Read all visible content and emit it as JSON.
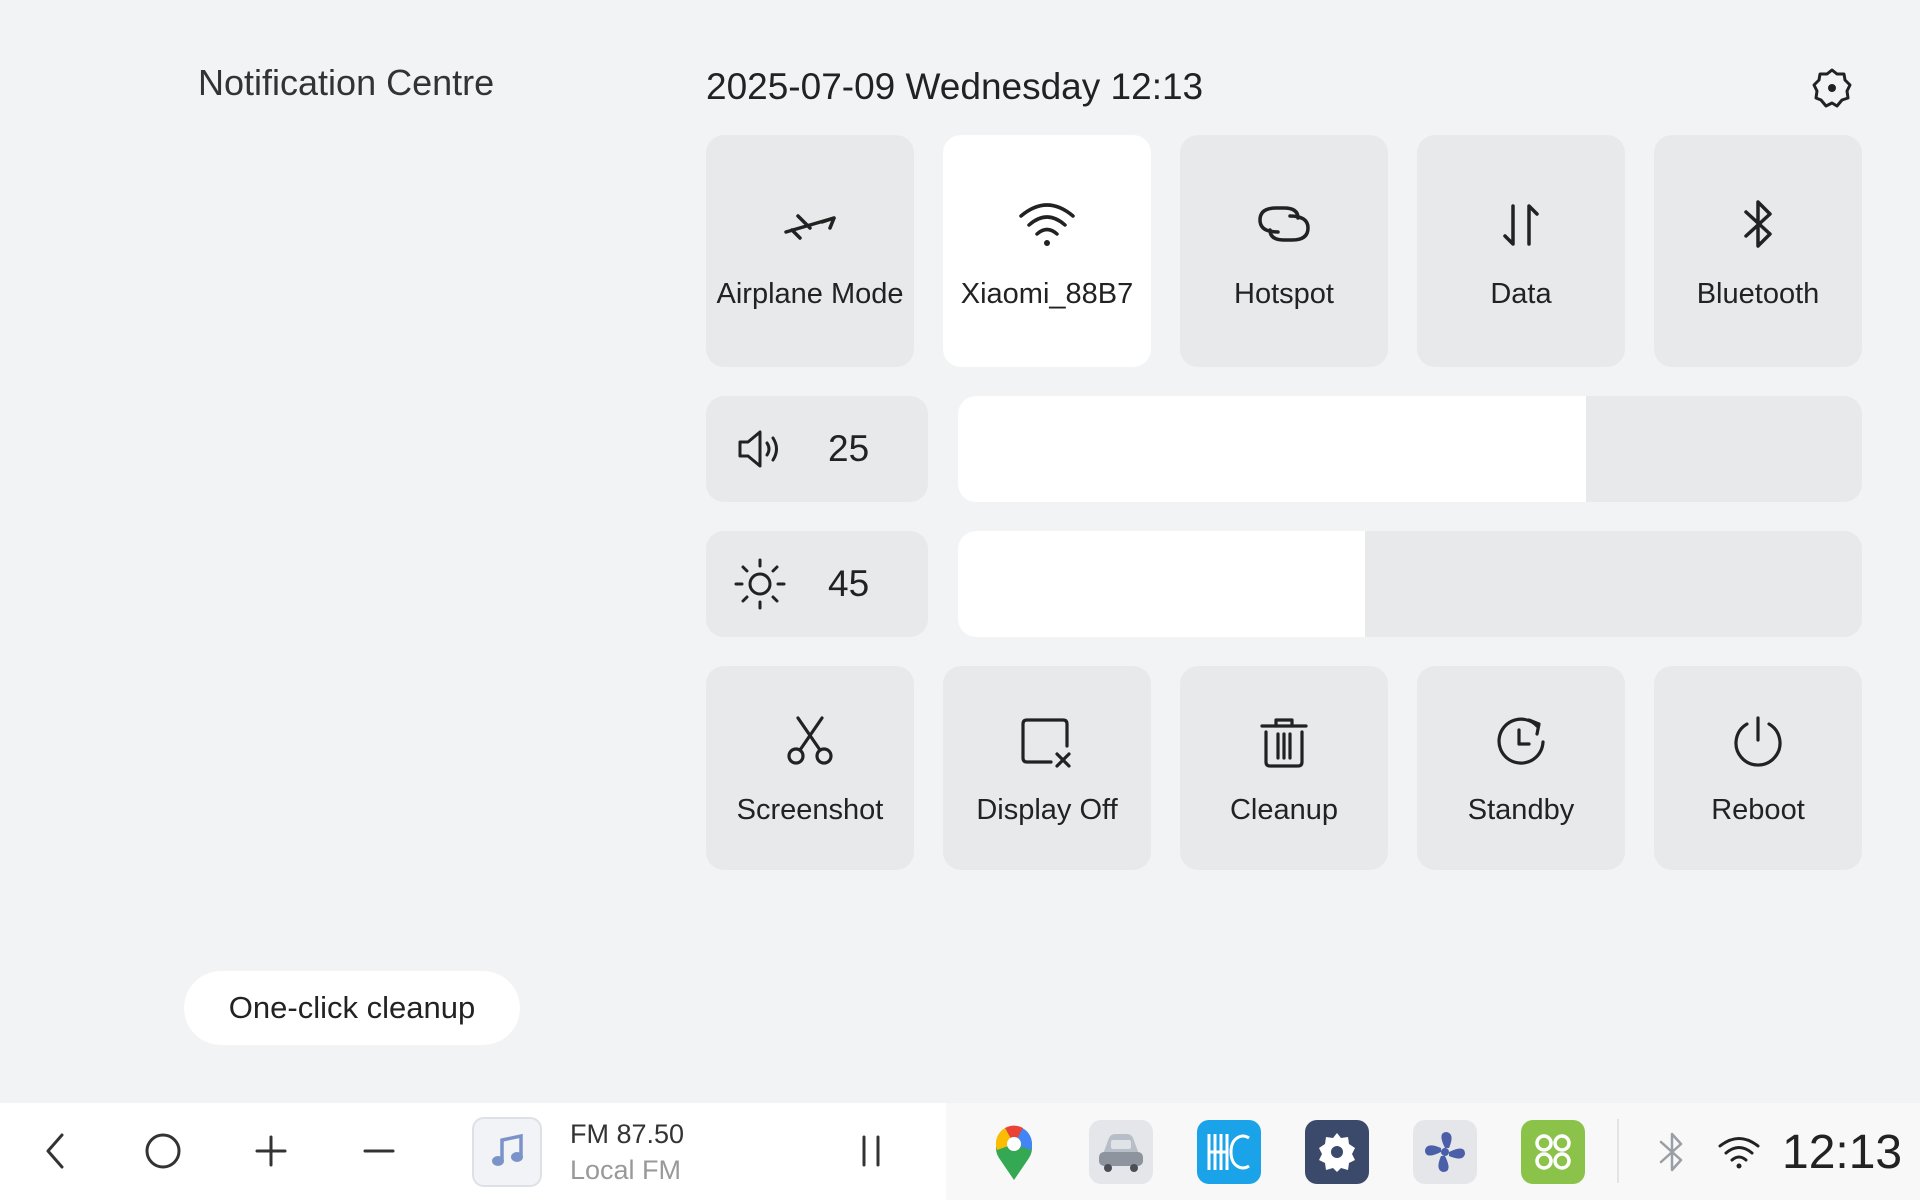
{
  "notification_centre": {
    "title": "Notification Centre"
  },
  "datetime": "2025-07-09 Wednesday 12:13",
  "settings": {
    "icon": "gear-icon"
  },
  "toggles": [
    {
      "label": "Airplane Mode",
      "icon": "airplane-icon",
      "active": false
    },
    {
      "label": "Xiaomi_88B7",
      "icon": "wifi-icon",
      "active": true
    },
    {
      "label": "Hotspot",
      "icon": "hotspot-icon",
      "active": false
    },
    {
      "label": "Data",
      "icon": "mobile-data-icon",
      "active": false
    },
    {
      "label": "Bluetooth",
      "icon": "bluetooth-icon",
      "active": false
    }
  ],
  "volume": {
    "value": "25",
    "level_percent": 69.5,
    "icon": "speaker-icon"
  },
  "brightness": {
    "value": "45",
    "level_percent": 45,
    "icon": "sun-icon"
  },
  "actions": [
    {
      "label": "Screenshot",
      "icon": "scissors-icon"
    },
    {
      "label": "Display Off",
      "icon": "display-off-icon"
    },
    {
      "label": "Cleanup",
      "icon": "trash-icon"
    },
    {
      "label": "Standby",
      "icon": "standby-icon"
    },
    {
      "label": "Reboot",
      "icon": "power-icon"
    }
  ],
  "cleanup_button": {
    "label": "One-click cleanup"
  },
  "taskbar": {
    "nav": [
      "back-icon",
      "home-icon",
      "plus-icon",
      "minus-icon"
    ],
    "media": {
      "frequency": "FM 87.50",
      "station": "Local FM",
      "art_icon": "music-note-icon",
      "control_icon": "pause-icon"
    },
    "apps": [
      "maps-icon",
      "car-icon",
      "hc-app-icon",
      "settings-app-icon",
      "fan-icon",
      "apps-grid-icon"
    ],
    "status": {
      "bluetooth_icon": "bluetooth-status-icon",
      "wifi_icon": "wifi-status-icon",
      "clock": "12:13"
    }
  },
  "colors": {
    "background": "#f2f3f5",
    "tile": "#e8e9eb",
    "active_tile": "#ffffff",
    "text": "#222222"
  }
}
